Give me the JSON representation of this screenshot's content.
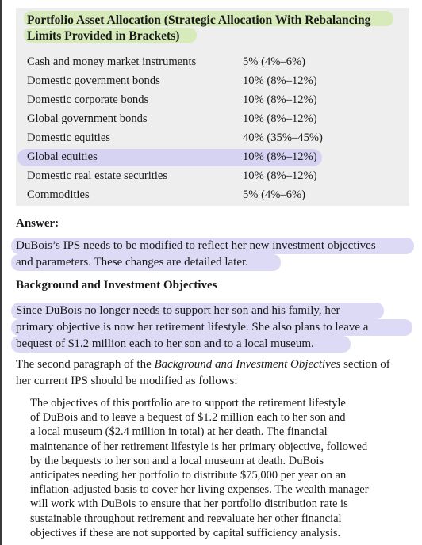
{
  "allocation_box": {
    "title_line1": "Portfolio Asset Allocation (Strategic Allocation With Rebalancing",
    "title_line2": "Limits Provided in Brackets)",
    "rows": [
      {
        "label": "Cash and money market instruments",
        "value": "5% (4%–6%)"
      },
      {
        "label": "Domestic government bonds",
        "value": "10% (8%–12%)"
      },
      {
        "label": "Domestic corporate bonds",
        "value": "10% (8%–12%)"
      },
      {
        "label": "Global government bonds",
        "value": "10% (8%–12%)"
      },
      {
        "label": "Domestic equities",
        "value": "40% (35%–45%)"
      },
      {
        "label": "Global equities",
        "value": "10% (8%–12%)"
      },
      {
        "label": "Domestic real estate securities",
        "value": "10% (8%–12%)"
      },
      {
        "label": "Commodities",
        "value": "5% (4%–6%)"
      }
    ]
  },
  "answer": {
    "heading": "Answer:",
    "line1": "DuBois’s IPS needs to be modified to reflect her new investment objectives",
    "line2": "and parameters. These changes are detailed later."
  },
  "background": {
    "heading": "Background and Investment Objectives",
    "line1": "Since DuBois no longer needs to support her son and his family, her",
    "line2": "primary objective is now her retirement lifestyle. She also plans to leave a",
    "line3": "bequest of $1.2 million each to her son and to a local museum."
  },
  "second_paragraph": {
    "line1_a": "The second paragraph of the ",
    "line1_b": "Background and Investment Objectives",
    "line1_c": " section of",
    "line2": "her current IPS should be modified as follows:"
  },
  "quote": {
    "lines": [
      "The objectives of this portfolio are to support the retirement lifestyle",
      "of DuBois and to leave a bequest of $1.2 million each to her son and",
      "a local museum ($2.4 million in total) at her death. The financial",
      "maintenance of her retirement lifestyle is her primary objective, followed",
      "by the bequests to her son and a local museum at death. DuBois",
      "anticipates needing her portfolio to distribute $75,000 per year on an",
      "inflation-adjusted basis to cover her living expenses. The wealth manager",
      "will work with DuBois to ensure that her portfolio distribution rate is",
      "sustainable throughout retirement and reevaluate her other financial",
      "objectives if these are not supported by capital sufficiency analysis."
    ]
  },
  "colors": {
    "box_bg": "#eeeeee",
    "highlight_green": "#cde8a8",
    "highlight_purple": "#dddaf5"
  }
}
